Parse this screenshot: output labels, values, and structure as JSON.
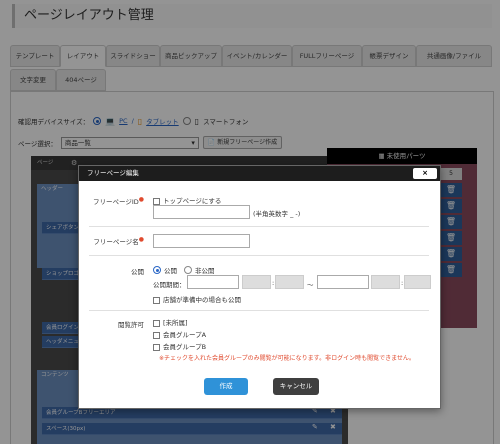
{
  "page": {
    "title": "ページレイアウト管理"
  },
  "tabs": [
    {
      "label": "テンプレート"
    },
    {
      "label": "レイアウト",
      "active": true
    },
    {
      "label": "スライドショー"
    },
    {
      "label": "商品ピックアップ"
    },
    {
      "label": "イベント/カレンダー"
    },
    {
      "label": "FULLフリーページ"
    },
    {
      "label": "帳票デザイン"
    },
    {
      "label": "共通画像/ファイル"
    },
    {
      "label": "文字変更"
    },
    {
      "label": "404ページ"
    }
  ],
  "device": {
    "label": "確認用デバイスサイズ：",
    "options": [
      {
        "label": "PC",
        "icon": "laptop-icon",
        "checked": true
      },
      {
        "label": "タブレット",
        "icon": "tablet-icon",
        "checked": false
      },
      {
        "label": "スマートフォン",
        "icon": "smartphone-icon",
        "checked": false
      }
    ]
  },
  "page_select": {
    "label": "ページ選択：",
    "value": "商品一覧",
    "new_button": "新規フリーページ作成"
  },
  "background_editor": {
    "header_label": "ページ",
    "sections": [
      "ヘッダー",
      "コンテンツ"
    ],
    "items": [
      "シェアボタン",
      "ショップロゴ",
      "会員ログイン",
      "ヘッダメニュー",
      "会員グループBフリーエリア",
      "スペース(30px)"
    ]
  },
  "unused_parts": {
    "title": "未使用パーツ",
    "number": "5"
  },
  "modal": {
    "title": "フリーページ編集",
    "close": "×",
    "free_page_id": {
      "label": "フリーページID",
      "top_page_checkbox": "トップページにする",
      "hint": "(半角英数字 _ -)"
    },
    "free_page_name": {
      "label": "フリーページ名"
    },
    "publish": {
      "label": "公開",
      "options": [
        "公開",
        "非公開"
      ],
      "period_label": "公開期間：",
      "tilde": "〜",
      "colon": ":",
      "prep_checkbox": "店舗が準備中の場合も公開"
    },
    "view_permission": {
      "label": "閲覧許可",
      "options": [
        "[未所属]",
        "会員グループA",
        "会員グループB"
      ],
      "note": "※チェックを入れた会員グループのみ閲覧が可能になります。非ログイン時も閲覧できません。"
    },
    "buttons": {
      "create": "作成",
      "cancel": "キャンセル"
    }
  }
}
